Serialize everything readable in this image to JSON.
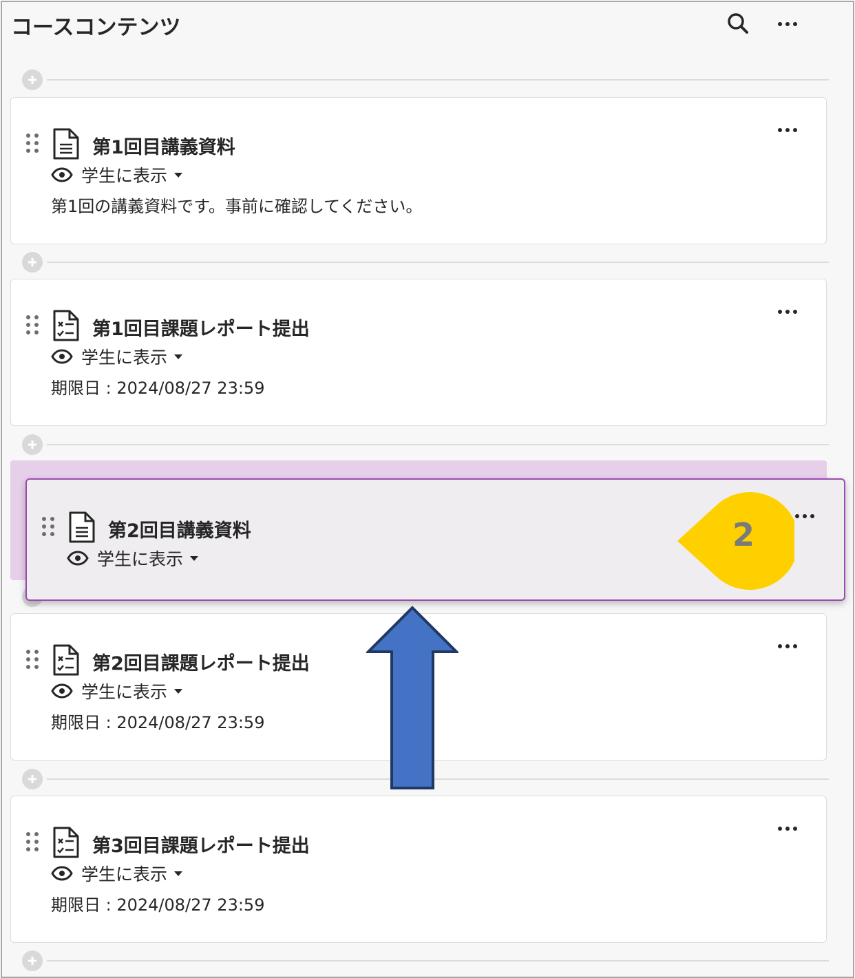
{
  "header": {
    "title": "コースコンテンツ",
    "search_icon": "search-icon",
    "more_icon": "more-horizontal-icon"
  },
  "items": [
    {
      "title": "第1回目講義資料",
      "icon": "document-icon",
      "visibility": "学生に表示",
      "description": "第1回の講義資料です。事前に確認してください。"
    },
    {
      "title": "第1回目課題レポート提出",
      "icon": "assignment-icon",
      "visibility": "学生に表示",
      "description": "期限日 : 2024/08/27 23:59"
    },
    {
      "title": "第2回目講義資料",
      "icon": "document-icon",
      "visibility": "学生に表示",
      "state": "dragging"
    },
    {
      "title": "第2回目課題レポート提出",
      "icon": "assignment-icon",
      "visibility": "学生に表示",
      "description": "期限日 : 2024/08/27 23:59"
    },
    {
      "title": "第3回目課題レポート提出",
      "icon": "assignment-icon",
      "visibility": "学生に表示",
      "description": "期限日 : 2024/08/27 23:59"
    }
  ],
  "annotation": {
    "step_number": "2",
    "callout_color": "#ffd000",
    "arrow_color": "#4472c4",
    "arrow_direction": "up"
  },
  "colors": {
    "drop_zone": "#e6cfe9",
    "drag_border": "#9a4bb4"
  }
}
